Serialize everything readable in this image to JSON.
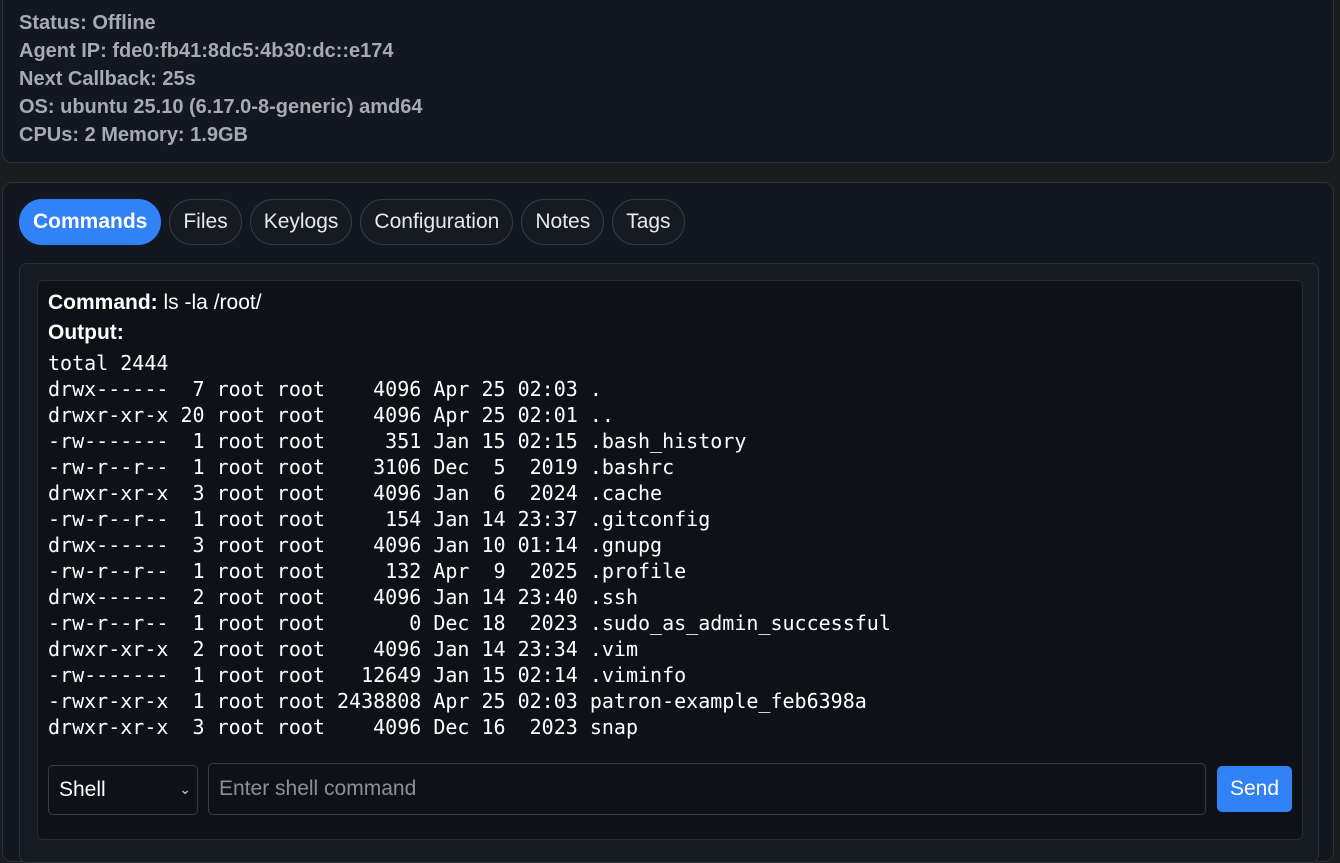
{
  "agent_info": {
    "lines": [
      "Status: Offline",
      "Agent IP: fde0:fb41:8dc5:4b30:dc::e174",
      "Next Callback: 25s",
      "OS: ubuntu 25.10 (6.17.0-8-generic) amd64",
      "CPUs: 2 Memory: 1.9GB"
    ]
  },
  "tabs": [
    {
      "label": "Commands",
      "active": true
    },
    {
      "label": "Files"
    },
    {
      "label": "Keylogs"
    },
    {
      "label": "Configuration"
    },
    {
      "label": "Notes"
    },
    {
      "label": "Tags"
    }
  ],
  "command": {
    "command_label": "Command:",
    "command_value": "ls -la /root/",
    "output_label": "Output:",
    "output_lines": [
      "total 2444",
      "drwx------  7 root root    4096 Apr 25 02:03 .",
      "drwxr-xr-x 20 root root    4096 Apr 25 02:01 ..",
      "-rw-------  1 root root     351 Jan 15 02:15 .bash_history",
      "-rw-r--r--  1 root root    3106 Dec  5  2019 .bashrc",
      "drwxr-xr-x  3 root root    4096 Jan  6  2024 .cache",
      "-rw-r--r--  1 root root     154 Jan 14 23:37 .gitconfig",
      "drwx------  3 root root    4096 Jan 10 01:14 .gnupg",
      "-rw-r--r--  1 root root     132 Apr  9  2025 .profile",
      "drwx------  2 root root    4096 Jan 14 23:40 .ssh",
      "-rw-r--r--  1 root root       0 Dec 18  2023 .sudo_as_admin_successful",
      "drwxr-xr-x  2 root root    4096 Jan 14 23:34 .vim",
      "-rw-------  1 root root   12649 Jan 15 02:14 .viminfo",
      "-rwxr-xr-x  1 root root 2438808 Apr 25 02:03 patron-example_feb6398a",
      "drwxr-xr-x  3 root root    4096 Dec 16  2023 snap"
    ]
  },
  "input": {
    "shell_selected": "Shell",
    "placeholder": "Enter shell command",
    "value": "",
    "send_label": "Send"
  },
  "colors": {
    "accent": "#3182f6",
    "background": "#131820",
    "muted_text": "#a5abb5"
  }
}
